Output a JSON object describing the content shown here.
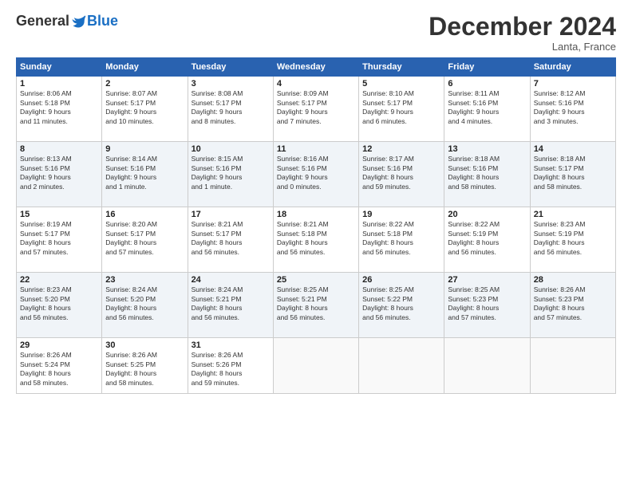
{
  "header": {
    "logo_general": "General",
    "logo_blue": "Blue",
    "month_title": "December 2024",
    "location": "Lanta, France"
  },
  "weekdays": [
    "Sunday",
    "Monday",
    "Tuesday",
    "Wednesday",
    "Thursday",
    "Friday",
    "Saturday"
  ],
  "weeks": [
    [
      {
        "day": "1",
        "sunrise": "8:06 AM",
        "sunset": "5:18 PM",
        "daylight": "9 hours and 11 minutes."
      },
      {
        "day": "2",
        "sunrise": "8:07 AM",
        "sunset": "5:17 PM",
        "daylight": "9 hours and 10 minutes."
      },
      {
        "day": "3",
        "sunrise": "8:08 AM",
        "sunset": "5:17 PM",
        "daylight": "9 hours and 8 minutes."
      },
      {
        "day": "4",
        "sunrise": "8:09 AM",
        "sunset": "5:17 PM",
        "daylight": "9 hours and 7 minutes."
      },
      {
        "day": "5",
        "sunrise": "8:10 AM",
        "sunset": "5:17 PM",
        "daylight": "9 hours and 6 minutes."
      },
      {
        "day": "6",
        "sunrise": "8:11 AM",
        "sunset": "5:16 PM",
        "daylight": "9 hours and 4 minutes."
      },
      {
        "day": "7",
        "sunrise": "8:12 AM",
        "sunset": "5:16 PM",
        "daylight": "9 hours and 3 minutes."
      }
    ],
    [
      {
        "day": "8",
        "sunrise": "8:13 AM",
        "sunset": "5:16 PM",
        "daylight": "9 hours and 2 minutes."
      },
      {
        "day": "9",
        "sunrise": "8:14 AM",
        "sunset": "5:16 PM",
        "daylight": "9 hours and 1 minute."
      },
      {
        "day": "10",
        "sunrise": "8:15 AM",
        "sunset": "5:16 PM",
        "daylight": "9 hours and 1 minute."
      },
      {
        "day": "11",
        "sunrise": "8:16 AM",
        "sunset": "5:16 PM",
        "daylight": "9 hours and 0 minutes."
      },
      {
        "day": "12",
        "sunrise": "8:17 AM",
        "sunset": "5:16 PM",
        "daylight": "8 hours and 59 minutes."
      },
      {
        "day": "13",
        "sunrise": "8:18 AM",
        "sunset": "5:16 PM",
        "daylight": "8 hours and 58 minutes."
      },
      {
        "day": "14",
        "sunrise": "8:18 AM",
        "sunset": "5:17 PM",
        "daylight": "8 hours and 58 minutes."
      }
    ],
    [
      {
        "day": "15",
        "sunrise": "8:19 AM",
        "sunset": "5:17 PM",
        "daylight": "8 hours and 57 minutes."
      },
      {
        "day": "16",
        "sunrise": "8:20 AM",
        "sunset": "5:17 PM",
        "daylight": "8 hours and 57 minutes."
      },
      {
        "day": "17",
        "sunrise": "8:21 AM",
        "sunset": "5:17 PM",
        "daylight": "8 hours and 56 minutes."
      },
      {
        "day": "18",
        "sunrise": "8:21 AM",
        "sunset": "5:18 PM",
        "daylight": "8 hours and 56 minutes."
      },
      {
        "day": "19",
        "sunrise": "8:22 AM",
        "sunset": "5:18 PM",
        "daylight": "8 hours and 56 minutes."
      },
      {
        "day": "20",
        "sunrise": "8:22 AM",
        "sunset": "5:19 PM",
        "daylight": "8 hours and 56 minutes."
      },
      {
        "day": "21",
        "sunrise": "8:23 AM",
        "sunset": "5:19 PM",
        "daylight": "8 hours and 56 minutes."
      }
    ],
    [
      {
        "day": "22",
        "sunrise": "8:23 AM",
        "sunset": "5:20 PM",
        "daylight": "8 hours and 56 minutes."
      },
      {
        "day": "23",
        "sunrise": "8:24 AM",
        "sunset": "5:20 PM",
        "daylight": "8 hours and 56 minutes."
      },
      {
        "day": "24",
        "sunrise": "8:24 AM",
        "sunset": "5:21 PM",
        "daylight": "8 hours and 56 minutes."
      },
      {
        "day": "25",
        "sunrise": "8:25 AM",
        "sunset": "5:21 PM",
        "daylight": "8 hours and 56 minutes."
      },
      {
        "day": "26",
        "sunrise": "8:25 AM",
        "sunset": "5:22 PM",
        "daylight": "8 hours and 56 minutes."
      },
      {
        "day": "27",
        "sunrise": "8:25 AM",
        "sunset": "5:23 PM",
        "daylight": "8 hours and 57 minutes."
      },
      {
        "day": "28",
        "sunrise": "8:26 AM",
        "sunset": "5:23 PM",
        "daylight": "8 hours and 57 minutes."
      }
    ],
    [
      {
        "day": "29",
        "sunrise": "8:26 AM",
        "sunset": "5:24 PM",
        "daylight": "8 hours and 58 minutes."
      },
      {
        "day": "30",
        "sunrise": "8:26 AM",
        "sunset": "5:25 PM",
        "daylight": "8 hours and 58 minutes."
      },
      {
        "day": "31",
        "sunrise": "8:26 AM",
        "sunset": "5:26 PM",
        "daylight": "8 hours and 59 minutes."
      },
      null,
      null,
      null,
      null
    ]
  ]
}
